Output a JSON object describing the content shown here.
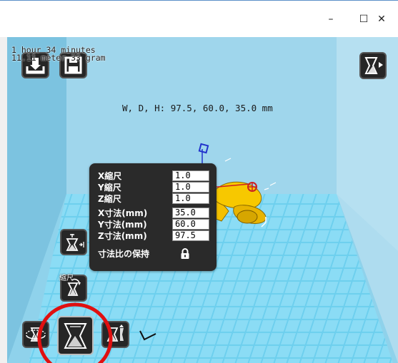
{
  "window": {
    "minimize_label": "–",
    "maximize_label": "☐",
    "close_label": "✕"
  },
  "toolbar": {
    "load_icon": "load-model-icon",
    "save_icon": "save-icon",
    "view_mode_icon": "view-mode-icon"
  },
  "status": {
    "print_time": "1 hour 34 minutes",
    "material": "11.11 meter 33 gram"
  },
  "model": {
    "dimensions": "W, D, H: 97.5, 60.0, 35.0 mm"
  },
  "scale_panel": {
    "rows": [
      {
        "label": "X縮尺",
        "value": "1.0"
      },
      {
        "label": "Y縮尺",
        "value": "1.0"
      },
      {
        "label": "Z縮尺",
        "value": "1.0"
      },
      {
        "label": "X寸法(mm)",
        "value": "35.0"
      },
      {
        "label": "Y寸法(mm)",
        "value": "60.0"
      },
      {
        "label": "Z寸法(mm)",
        "value": "97.5"
      }
    ],
    "uniform_label": "寸法比の保持",
    "lock_icon": "lock-icon"
  },
  "tools": {
    "tooltip": "縮尺",
    "items": [
      "rotate-icon",
      "scale-icon",
      "mirror-icon",
      "reset-scale-icon",
      "lay-flat-icon"
    ]
  },
  "colors": {
    "backdrop": "#8fd2eb",
    "floor": "#6dcfee",
    "grid": "#3aa8d8",
    "model": "#f5c000",
    "panel": "#2a2a2a",
    "highlight_circle": "#e01010"
  }
}
